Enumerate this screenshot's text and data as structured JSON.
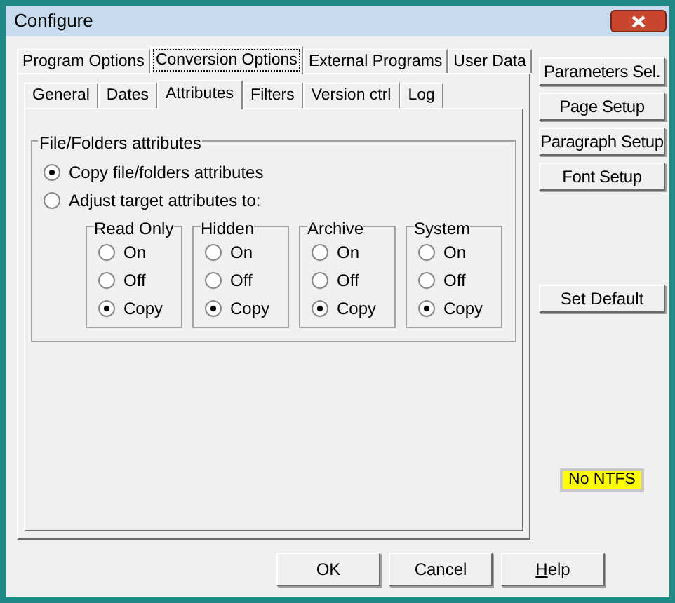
{
  "window": {
    "title": "Configure"
  },
  "tabs": [
    {
      "label": "Program Options",
      "selected": false
    },
    {
      "label": "Conversion Options",
      "selected": true
    },
    {
      "label": "External Programs",
      "selected": false
    },
    {
      "label": "User Data",
      "selected": false
    }
  ],
  "subtabs": [
    {
      "label": "General",
      "selected": false
    },
    {
      "label": "Dates",
      "selected": false
    },
    {
      "label": "Attributes",
      "selected": true
    },
    {
      "label": "Filters",
      "selected": false
    },
    {
      "label": "Version ctrl",
      "selected": false
    },
    {
      "label": "Log",
      "selected": false
    }
  ],
  "attributes_group": {
    "title": "File/Folders attributes",
    "options": [
      {
        "label": "Copy file/folders attributes",
        "selected": true
      },
      {
        "label": "Adjust target attributes to:",
        "selected": false
      }
    ],
    "targets": [
      {
        "title": "Read Only",
        "options": [
          {
            "label": "On",
            "selected": false
          },
          {
            "label": "Off",
            "selected": false
          },
          {
            "label": "Copy",
            "selected": true
          }
        ]
      },
      {
        "title": "Hidden",
        "options": [
          {
            "label": "On",
            "selected": false
          },
          {
            "label": "Off",
            "selected": false
          },
          {
            "label": "Copy",
            "selected": true
          }
        ]
      },
      {
        "title": "Archive",
        "options": [
          {
            "label": "On",
            "selected": false
          },
          {
            "label": "Off",
            "selected": false
          },
          {
            "label": "Copy",
            "selected": true
          }
        ]
      },
      {
        "title": "System",
        "options": [
          {
            "label": "On",
            "selected": false
          },
          {
            "label": "Off",
            "selected": false
          },
          {
            "label": "Copy",
            "selected": true
          }
        ]
      }
    ]
  },
  "side_buttons": [
    "Parameters Sel.",
    "Page Setup",
    "Paragraph Setup",
    "Font Setup"
  ],
  "default_button": "Set Default",
  "status_badge": "No NTFS",
  "buttons": [
    {
      "label": "OK",
      "underline_first": false
    },
    {
      "label": "Cancel",
      "underline_first": false
    },
    {
      "label": "Help",
      "underline_first": true
    }
  ]
}
